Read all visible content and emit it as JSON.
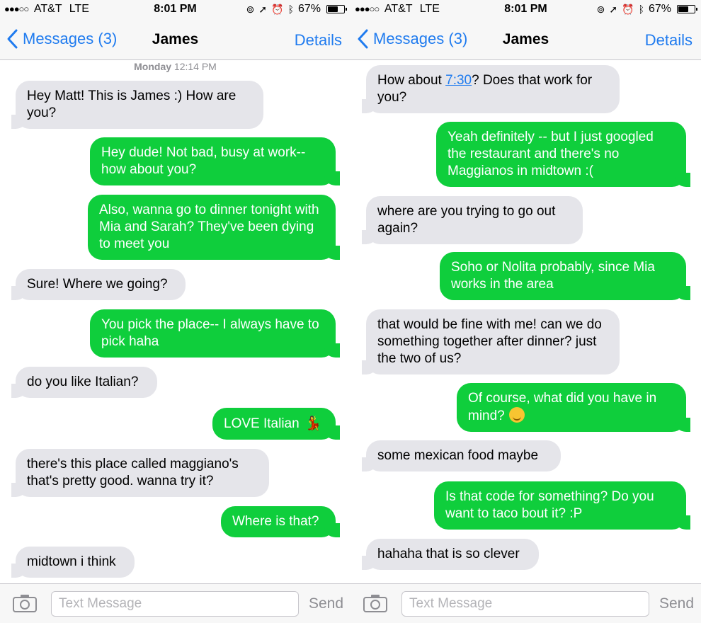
{
  "screens": [
    {
      "status": {
        "signal": "●●●○○",
        "carrier": "AT&T",
        "network": "LTE",
        "time": "8:01 PM",
        "battery": "67%",
        "battery_level": 0.67
      },
      "nav": {
        "back_label": "Messages (3)",
        "title": "James",
        "details_label": "Details"
      },
      "timestamp": {
        "day": "Monday",
        "time": "12:14 PM"
      },
      "messages": [
        {
          "dir": "in",
          "text": "Hey Matt! This is James :) How are you?"
        },
        {
          "dir": "out",
          "text": "Hey dude! Not bad, busy at work-- how about you?"
        },
        {
          "dir": "out",
          "text": "Also, wanna go to dinner tonight with Mia and Sarah? They've been dying to meet you"
        },
        {
          "dir": "in",
          "text": "Sure! Where we going?"
        },
        {
          "dir": "out",
          "text": "You pick the place-- I always have to pick haha"
        },
        {
          "dir": "in",
          "text": "do you like Italian?"
        },
        {
          "dir": "out",
          "text": "LOVE Italian",
          "emoji": "dancer-emoji"
        },
        {
          "dir": "in",
          "text": "there's this place called maggiano's that's pretty good. wanna try it?"
        },
        {
          "dir": "out",
          "text": "Where is that?"
        },
        {
          "dir": "in",
          "text": "midtown i think"
        }
      ],
      "input": {
        "placeholder": "Text Message",
        "value": "",
        "send_label": "Send"
      }
    },
    {
      "status": {
        "signal": "●●●○○",
        "carrier": "AT&T",
        "network": "LTE",
        "time": "8:01 PM",
        "battery": "67%",
        "battery_level": 0.67
      },
      "nav": {
        "back_label": "Messages (3)",
        "title": "James",
        "details_label": "Details"
      },
      "messages": [
        {
          "dir": "in",
          "text_before": "How about ",
          "link": "7:30",
          "text_after": "? Does that work for you?"
        },
        {
          "dir": "out",
          "text": "Yeah definitely -- but I just googled the restaurant and there's no Maggianos in midtown :("
        },
        {
          "dir": "in",
          "text": "where are you trying to go out again?"
        },
        {
          "dir": "out",
          "text": "Soho or Nolita probably, since Mia works in the area"
        },
        {
          "dir": "in",
          "text": "that would be fine with me! can we do something together after dinner? just the two of us?"
        },
        {
          "dir": "out",
          "text": "Of course, what did you have in mind?",
          "emoji": "smirk-emoji"
        },
        {
          "dir": "in",
          "text": "some mexican food maybe"
        },
        {
          "dir": "out",
          "text": "Is that code for something? Do you want to taco bout it? :P"
        },
        {
          "dir": "in",
          "text": "hahaha that is so clever"
        }
      ],
      "input": {
        "placeholder": "Text Message",
        "value": "",
        "send_label": "Send"
      }
    }
  ],
  "colors": {
    "accent": "#1f7bef",
    "outgoing_bubble": "#0fce3c",
    "incoming_bubble": "#e5e5ea",
    "muted": "#8e8e93"
  }
}
